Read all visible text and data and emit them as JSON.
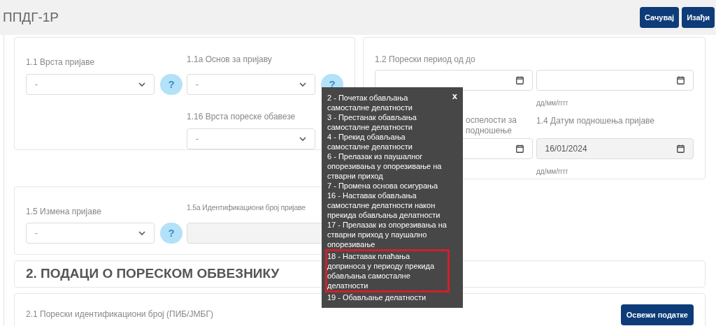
{
  "header": {
    "title": "ППДГ-1Р",
    "buttons": [
      "Сачувај",
      "Изађи"
    ]
  },
  "section_1_left": {
    "fields": [
      {
        "label": "1.1 Врста пријаве",
        "value": "-",
        "help": "?"
      },
      {
        "label": "1.1а Основ за пријаву",
        "value": "-",
        "help": "?"
      },
      {
        "label": "1.16 Врста пореске обавезе",
        "value": "-"
      }
    ]
  },
  "section_1_right": {
    "period_label": "1.2 Порески период од до",
    "period_hint": "дд/мм/гггг",
    "due_label_fragment": "оспелости за подношење",
    "filing_label": "1.4 Датум подношења пријаве",
    "filing_value": "16/01/2024",
    "filing_hint": "дд/мм/гггг"
  },
  "amendment": {
    "label": "1.5 Измена пријаве",
    "value": "-",
    "help": "?",
    "id_label": "1.5а Идентификациони број пријаве"
  },
  "section_2": {
    "title": "2. ПОДАЦИ О ПОРЕСКОМ ОБВЕЗНИКУ",
    "pib_label": "2.1 Порески идентификациони број (ПИБ/ЈМБГ)",
    "refresh_button": "Освежи податке"
  },
  "tooltip": {
    "close": "x",
    "items": [
      {
        "text": "2 - Почетак обављања самосталне делатности",
        "highlighted": false
      },
      {
        "text": "3 - Престанак обављања самосталне делатности",
        "highlighted": false
      },
      {
        "text": "4 - Прекид обављања самосталне делатности",
        "highlighted": false
      },
      {
        "text": "6 - Прелазак из паушалног опорезивања у опорезивање на стварни приход",
        "highlighted": false
      },
      {
        "text": "7 - Промена основа осигурања",
        "highlighted": false
      },
      {
        "text": "16 - Наставак обављања самосталне делатности након прекида обављања делатности",
        "highlighted": false
      },
      {
        "text": "17 - Прелазак из опорезивања на стварни приход у паушално опорезивање",
        "highlighted": false
      },
      {
        "text": "18 - Наставак плаћања доприноса у периоду прекида обављања самосталне делатности",
        "highlighted": true
      },
      {
        "text": "19 - Обављање делатности",
        "highlighted": false
      }
    ]
  }
}
